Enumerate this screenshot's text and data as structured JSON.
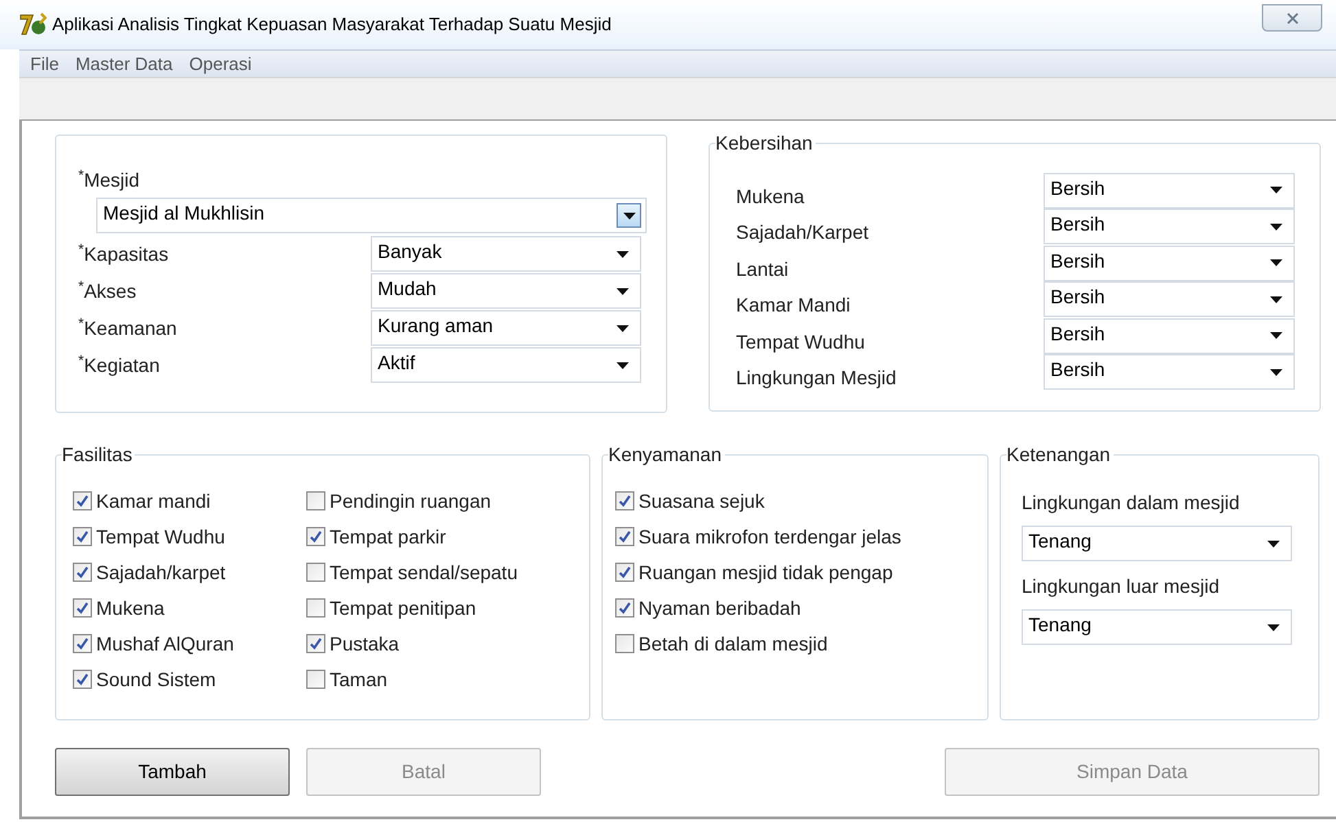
{
  "window": {
    "title": "Aplikasi Analisis Tingkat Kepuasan Masyarakat Terhadap Suatu Mesjid"
  },
  "menu": [
    "File",
    "Master Data",
    "Operasi"
  ],
  "main_form": {
    "fields": [
      {
        "label": "$^{*}$Mesjid",
        "value": "Mesjid al Mukhlisin",
        "kind": "wide"
      },
      {
        "label": "$^{*}$Kapasitas",
        "value": "Banyak",
        "kind": "inline"
      },
      {
        "label": "$^{*}$Akses",
        "value": "Mudah",
        "kind": "inline"
      },
      {
        "label": "$^{*}$Keamanan",
        "value": "Kurang aman",
        "kind": "inline"
      },
      {
        "label": "$^{*}$Kegiatan",
        "value": "Aktif",
        "kind": "inline"
      }
    ]
  },
  "kebersihan": {
    "title": "Kebersihan",
    "rows": [
      {
        "label": "Mukena",
        "value": "Bersih"
      },
      {
        "label": "Sajadah/Karpet",
        "value": "Bersih"
      },
      {
        "label": "Lantai",
        "value": "Bersih"
      },
      {
        "label": "Kamar Mandi",
        "value": "Bersih"
      },
      {
        "label": "Tempat Wudhu",
        "value": "Bersih"
      },
      {
        "label": "Lingkungan Mesjid",
        "value": "Bersih"
      }
    ]
  },
  "fasilitas": {
    "title": "Fasilitas",
    "columns": [
      [
        {
          "label": "Kamar mandi",
          "checked": true
        },
        {
          "label": "Tempat Wudhu",
          "checked": true
        },
        {
          "label": "Sajadah/karpet",
          "checked": true
        },
        {
          "label": "Mukena",
          "checked": true
        },
        {
          "label": "Mushaf AlQuran",
          "checked": true
        },
        {
          "label": "Sound Sistem",
          "checked": true
        }
      ],
      [
        {
          "label": "Pendingin ruangan",
          "checked": false
        },
        {
          "label": "Tempat parkir",
          "checked": true
        },
        {
          "label": "Tempat sendal/sepatu",
          "checked": false
        },
        {
          "label": "Tempat penitipan",
          "checked": false
        },
        {
          "label": "Pustaka",
          "checked": true
        },
        {
          "label": "Taman",
          "checked": false
        }
      ]
    ]
  },
  "kenyamanan": {
    "title": "Kenyamanan",
    "items": [
      {
        "label": "Suasana sejuk",
        "checked": true
      },
      {
        "label": "Suara mikrofon terdengar jelas",
        "checked": true
      },
      {
        "label": "Ruangan mesjid tidak pengap",
        "checked": true
      },
      {
        "label": "Nyaman beribadah",
        "checked": true
      },
      {
        "label": "Betah di dalam mesjid",
        "checked": false
      }
    ]
  },
  "ketenangan": {
    "title": "Ketenangan",
    "rows": [
      {
        "label": "Lingkungan dalam mesjid",
        "value": "Tenang"
      },
      {
        "label": "Lingkungan luar mesjid",
        "value": "Tenang"
      }
    ]
  },
  "buttons": [
    {
      "label": "Tambah",
      "disabled": false
    },
    {
      "label": "Batal",
      "disabled": true
    },
    {
      "label": "Simpan Data",
      "disabled": true
    }
  ]
}
